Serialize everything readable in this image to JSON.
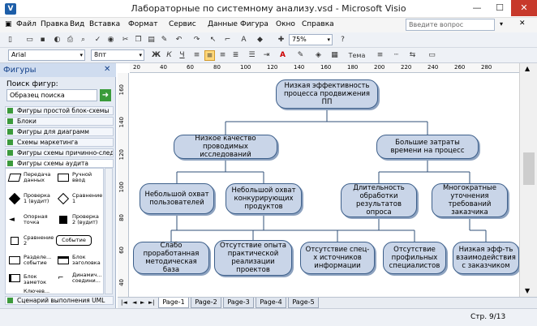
{
  "window": {
    "title": "Лабораторные по системному анализу.vsd - Microsoft Visio",
    "app_icon": "V"
  },
  "menu": [
    "Файл",
    "Правка",
    "Вид",
    "Вставка",
    "Формат",
    "Сервис",
    "Данные",
    "Фигура",
    "Окно",
    "Справка"
  ],
  "search": {
    "placeholder": "Введите вопрос"
  },
  "toolbar1": {
    "zoom": "75%"
  },
  "toolbar2": {
    "font": "Arial",
    "size": "8пт",
    "bold": "Ж",
    "italic": "К",
    "underline": "Ч",
    "theme": "Тема"
  },
  "shapes_panel": {
    "title": "Фигуры",
    "search_label": "Поиск фигур:",
    "search_value": "Образец поиска",
    "stencils": [
      "Фигуры простой блок-схемы",
      "Блоки",
      "Фигуры для диаграмм",
      "Схемы маркетинга",
      "Фигуры схемы причинно-следс...",
      "Фигуры схемы аудита"
    ],
    "items": [
      "Передача данных",
      "Ручной ввод",
      "Проверка 1 (вудит)",
      "Сравнение 1",
      "Опорная точка",
      "Проверка 2 (вудит)",
      "Сравнение 2",
      "Событие",
      "Разделе... событие",
      "Блок заголовка",
      "Блок заметок",
      "Динамич... соедини...",
      "Ключев..."
    ],
    "bottom_stencil": "Сценарий выполнения UML"
  },
  "hruler_ticks": [
    "20",
    "40",
    "60",
    "80",
    "100",
    "120",
    "140",
    "160",
    "180",
    "200",
    "220",
    "240",
    "260",
    "280"
  ],
  "vruler_ticks": [
    "160",
    "140",
    "120",
    "100",
    "80",
    "60",
    "40"
  ],
  "diagram": {
    "root": "Низкая эффективность процесса продвижения ПП",
    "l1_left": "Низкое качество проводимых исследований",
    "l1_right": "Большие затраты времени на процесс",
    "l2_a": "Небольшой охват пользователей",
    "l2_b": "Небольшой охват конкурирующих продуктов",
    "l2_c": "Длительность обработки результатов опроса",
    "l2_d": "Многократные уточнения требований заказчика",
    "l3_a": "Слабо проработанная методическая база",
    "l3_b": "Отсутствие опыта практической реализации проектов",
    "l3_c": "Отсутствие спец-х источников информации",
    "l3_d": "Отсутствие профильных специалистов",
    "l3_e": "Низкая эфф-ть взаимодействия с заказчиком"
  },
  "pages": [
    "Page-1",
    "Page-2",
    "Page-3",
    "Page-4",
    "Page-5"
  ],
  "status": {
    "page": "Стр. 9/13"
  }
}
